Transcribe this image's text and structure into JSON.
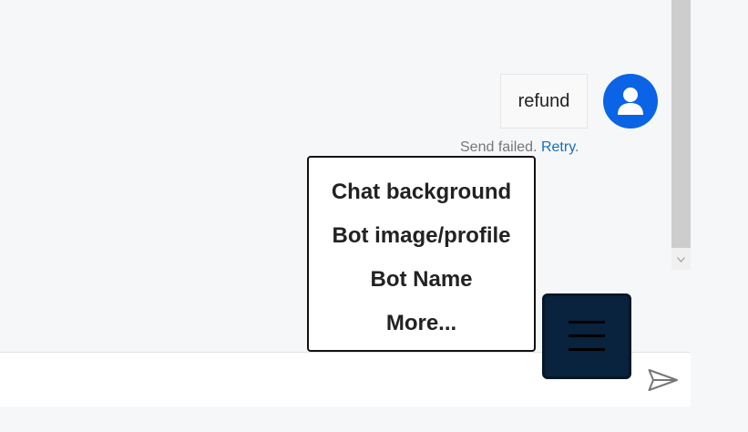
{
  "message": {
    "text": "refund",
    "status_text": "Send failed.",
    "retry_label": "Retry",
    "status_suffix": ".",
    "avatar_icon": "user-icon"
  },
  "menu": {
    "items": [
      {
        "label": "Chat background"
      },
      {
        "label": "Bot image/profile"
      },
      {
        "label": "Bot Name"
      },
      {
        "label": "More..."
      }
    ]
  },
  "composer": {
    "value": "",
    "send_icon": "send-icon"
  },
  "menu_button": {
    "icon": "hamburger-menu-icon"
  },
  "colors": {
    "avatar": "#0b63e5",
    "retry_link": "#1a6fb5",
    "menu_button": "#09223d"
  }
}
